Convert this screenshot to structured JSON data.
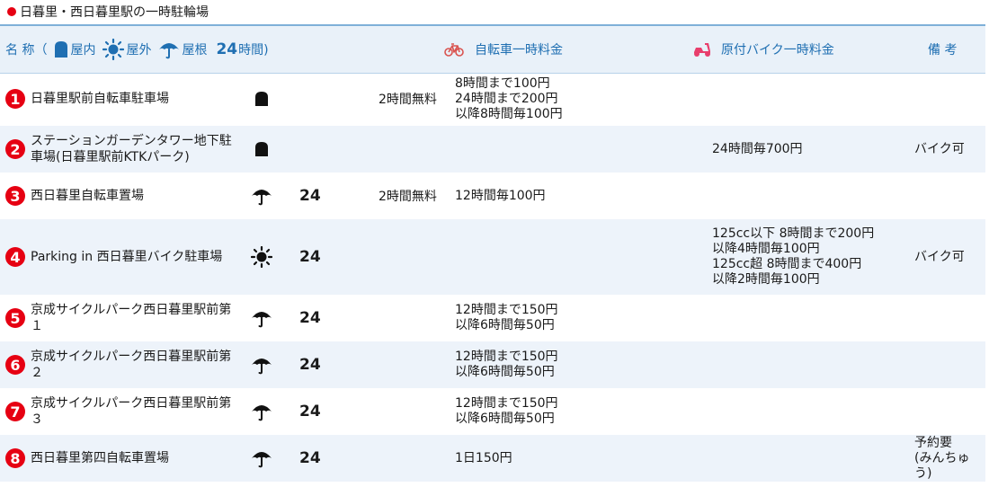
{
  "title": "日暮里・西日暮里駅の一時駐輪場",
  "colors": {
    "accent": "#1f6fb2",
    "badge": "#e60012",
    "header_bg": "#e9f1f9",
    "row_alt": "#edf3fa"
  },
  "header": {
    "name_label": "名 称（",
    "legend_indoor": "屋内",
    "legend_outdoor": "屋外",
    "legend_roof": "屋根",
    "legend_24": "24",
    "legend_24_suffix": "時間)",
    "bicycle_fee_label": "自転車一時料金",
    "moped_fee_label": "原付バイク一時料金",
    "notes_label": "備 考"
  },
  "rows": [
    {
      "num": "1",
      "name": "日暮里駅前自転車駐車場",
      "icon": "indoor-icon",
      "h24": "",
      "free": "2時間無料",
      "bicycle": "8時間まで100円\n24時間まで200円\n以降8時間毎100円",
      "moped": "",
      "note": ""
    },
    {
      "num": "2",
      "name": "ステーションガーデンタワー地下駐車場(日暮里駅前KTKパーク)",
      "icon": "indoor-icon",
      "h24": "",
      "free": "",
      "bicycle": "",
      "moped": "24時間毎700円",
      "note": "バイク可"
    },
    {
      "num": "3",
      "name": "西日暮里自転車置場",
      "icon": "roof-icon",
      "h24": "24",
      "free": "2時間無料",
      "bicycle": "12時間毎100円",
      "moped": "",
      "note": ""
    },
    {
      "num": "4",
      "name": "Parking in 西日暮里バイク駐車場",
      "icon": "outdoor-icon",
      "h24": "24",
      "free": "",
      "bicycle": "",
      "moped": "125cc以下 8時間まで200円\n以降4時間毎100円\n125cc超 8時間まで400円\n以降2時間毎100円",
      "note": "バイク可"
    },
    {
      "num": "5",
      "name": "京成サイクルパーク西日暮里駅前第１",
      "icon": "roof-icon",
      "h24": "24",
      "free": "",
      "bicycle": "12時間まで150円\n以降6時間毎50円",
      "moped": "",
      "note": ""
    },
    {
      "num": "6",
      "name": "京成サイクルパーク西日暮里駅前第２",
      "icon": "roof-icon",
      "h24": "24",
      "free": "",
      "bicycle": "12時間まで150円\n以降6時間毎50円",
      "moped": "",
      "note": ""
    },
    {
      "num": "7",
      "name": "京成サイクルパーク西日暮里駅前第３",
      "icon": "roof-icon",
      "h24": "24",
      "free": "",
      "bicycle": "12時間まで150円\n以降6時間毎50円",
      "moped": "",
      "note": ""
    },
    {
      "num": "8",
      "name": "西日暮里第四自転車置場",
      "icon": "roof-icon",
      "h24": "24",
      "free": "",
      "bicycle": "1日150円",
      "moped": "",
      "note": "予約要\n(みんちゅう)"
    }
  ]
}
